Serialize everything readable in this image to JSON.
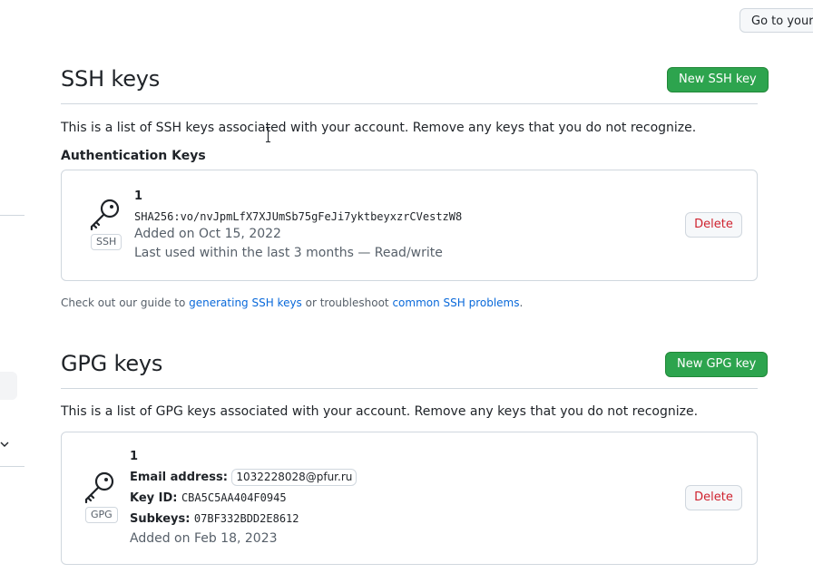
{
  "header": {
    "go_button_label": "Go to your personal profile"
  },
  "ssh": {
    "title": "SSH keys",
    "new_button_label": "New SSH key",
    "description": "This is a list of SSH keys associated with your account. Remove any keys that you do not recognize.",
    "subheading": "Authentication Keys",
    "keys": [
      {
        "title": "1",
        "icon": "key-icon",
        "type_badge": "SSH",
        "fingerprint": "SHA256:vo/nvJpmLfX7XJUmSb75gFeJi7yktbeyxzrCVestzW8",
        "added": "Added on Oct 15, 2022",
        "last_used": "Last used within the last 3 months — Read/write",
        "delete_label": "Delete"
      }
    ],
    "help": {
      "prefix": "Check out our guide to ",
      "link1": "generating SSH keys",
      "middle": " or troubleshoot ",
      "link2": "common SSH problems",
      "suffix": "."
    }
  },
  "gpg": {
    "title": "GPG keys",
    "new_button_label": "New GPG key",
    "description": "This is a list of GPG keys associated with your account. Remove any keys that you do not recognize.",
    "keys": [
      {
        "title": "1",
        "icon": "key-icon",
        "type_badge": "GPG",
        "email_label": "Email address:",
        "email": "1032228028@pfur.ru",
        "key_id_label": "Key ID:",
        "key_id": "CBA5C5AA404F0945",
        "subkeys_label": "Subkeys:",
        "subkeys": "07BF332BDD2E8612",
        "added": "Added on Feb 18, 2023",
        "delete_label": "Delete"
      }
    ]
  },
  "colors": {
    "primary_button": "#2da44e",
    "danger_text": "#cf222e",
    "link": "#0969da",
    "border": "#d0d7de"
  }
}
